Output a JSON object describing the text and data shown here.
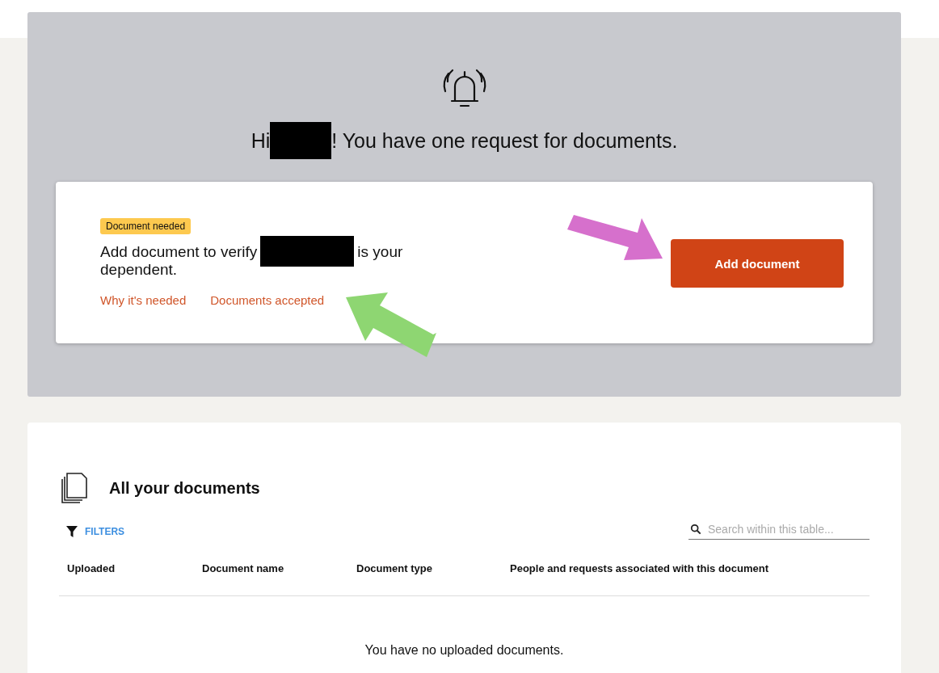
{
  "header": {
    "greeting_start": "Hi",
    "greeting_end": "! You have one request for documents."
  },
  "request": {
    "badge": "Document needed",
    "message_start": "Add document to verify",
    "message_end": "is your",
    "message_wrap": "dependent.",
    "links": [
      "Why it's needed",
      "Documents accepted"
    ],
    "button": "Add document"
  },
  "documents": {
    "title": "All your documents",
    "filter_label": "FILTERS",
    "search": {
      "placeholder": "Search within this table..."
    },
    "columns": [
      "Uploaded",
      "Document name",
      "Document type",
      "People and requests associated with this document"
    ],
    "empty_message": "You have no uploaded documents."
  }
}
